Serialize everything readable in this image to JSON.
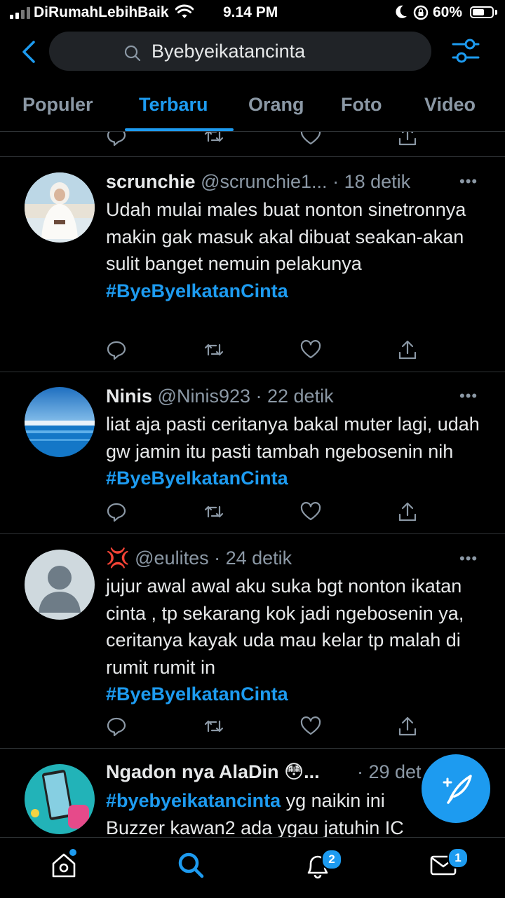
{
  "status_bar": {
    "carrier": "DiRumahLebihBaik",
    "time": "9.14 PM",
    "battery": "60%",
    "battery_level": 0.6
  },
  "search": {
    "query": "Byebyeikatancinta"
  },
  "tabs": [
    {
      "label": "Populer",
      "active": false
    },
    {
      "label": "Terbaru",
      "active": true
    },
    {
      "label": "Orang",
      "active": false
    },
    {
      "label": "Foto",
      "active": false
    },
    {
      "label": "Video",
      "active": false
    }
  ],
  "tweets": [
    {
      "name": "scrunchie",
      "handle": "@scrunchie1...",
      "time": "· 18 detik",
      "text": "Udah mulai males buat nonton sinetronnya makin gak masuk akal dibuat seakan-akan sulit banget nemuin pelakunya",
      "hashtag": "#ByeByeIkatanCinta"
    },
    {
      "name": "Ninis",
      "handle": "@Ninis923",
      "time": "· 22 detik",
      "text": "liat aja pasti ceritanya bakal muter lagi, udah gw jamin itu pasti tambah ngebosenin nih",
      "hashtag": "#ByeByeIkatanCinta"
    },
    {
      "name": "💢",
      "handle": "@eulites",
      "time": "· 24 detik",
      "text": "jujur awal awal aku suka bgt nonton ikatan cinta , tp sekarang kok jadi ngebosenin ya, ceritanya kayak uda mau kelar tp malah di rumit rumit in",
      "hashtag": "#ByeByeIkatanCinta"
    },
    {
      "name": "Ngadon nya AlaDin 😳...",
      "handle": "",
      "time": "· 29 det",
      "hashtag": "#byebyeikatancinta",
      "text_after": "yg naikin ini",
      "text_line2": "Buzzer kawan2 ada ygau jatuhin IC"
    }
  ],
  "bottom_nav": {
    "notifications_badge": "2",
    "messages_badge": "1"
  },
  "colors": {
    "accent": "#1d9bf0",
    "background": "#000000",
    "muted": "#8b98a5"
  }
}
